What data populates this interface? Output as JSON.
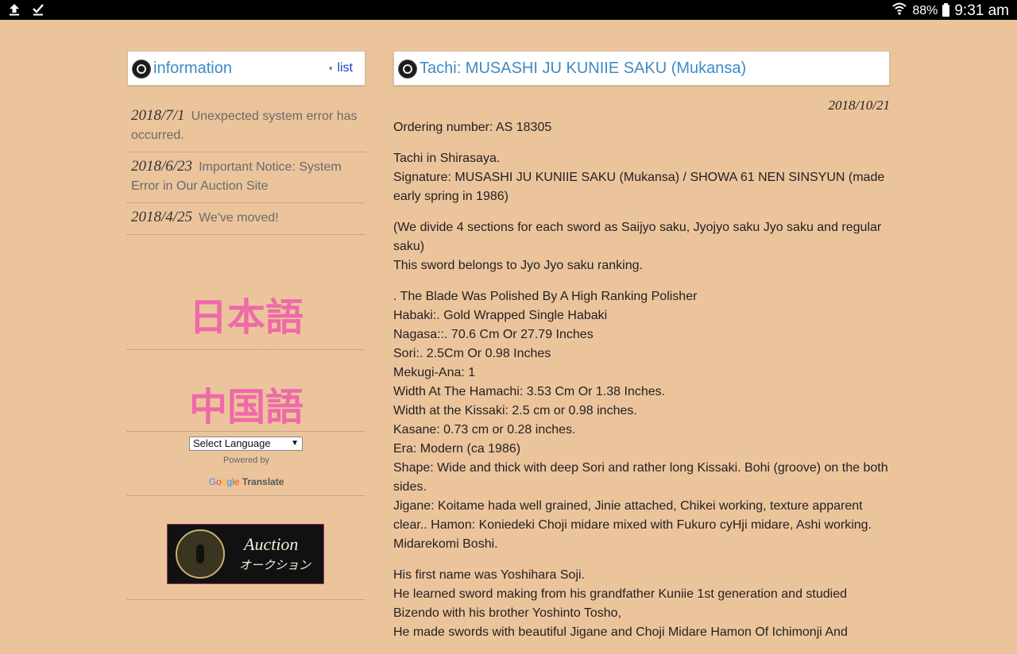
{
  "status_bar": {
    "battery": "88%",
    "time": "9:31 am"
  },
  "sidebar": {
    "info_title": "information",
    "list_label": "list",
    "news": [
      {
        "date": "2018/7/1",
        "text": "Unexpected system error has occurred."
      },
      {
        "date": "2018/6/23",
        "text": "Important Notice: System Error in Our Auction Site"
      },
      {
        "date": "2018/4/25",
        "text": "We've moved!"
      }
    ],
    "lang_japanese": "日本語",
    "lang_chinese": "中国語",
    "select_language": "Select Language",
    "powered_by": "Powered by",
    "google": [
      "G",
      "o",
      "o",
      "g",
      "l",
      "e"
    ],
    "translate": "Translate",
    "auction_en": "Auction",
    "auction_jp": "オークション"
  },
  "article": {
    "title": "Tachi: MUSASHI JU KUNIIE SAKU (Mukansa)",
    "date": "2018/10/21",
    "ordering": "Ordering number: AS 18305",
    "p1": [
      "Tachi in Shirasaya.",
      "Signature: MUSASHI JU KUNIIE SAKU (Mukansa) / SHOWA 61 NEN SINSYUN (made early spring in 1986)"
    ],
    "p2": [
      "(We divide 4 sections for each sword as Saijyo saku, Jyojyo saku Jyo saku and regular saku)",
      "This sword belongs to Jyo Jyo saku ranking."
    ],
    "p3": [
      ". The Blade Was Polished By A High Ranking Polisher",
      "Habaki:. Gold Wrapped Single Habaki",
      "Nagasa::. 70.6 Cm Or 27.79 Inches",
      "Sori:. 2.5Cm Or 0.98 Inches",
      "Mekugi-Ana: 1",
      "Width At The Hamachi: 3.53 Cm Or 1.38 Inches.",
      "Width at the Kissaki: 2.5 cm or 0.98 inches.",
      "Kasane: 0.73 cm or 0.28 inches.",
      "Era: Modern (ca 1986)",
      "Shape: Wide and thick with deep Sori and rather long Kissaki. Bohi (groove) on the both sides.",
      "Jigane: Koitame hada well grained, Jinie attached, Chikei working, texture apparent clear.. Hamon: Koniedeki Choji midare mixed with Fukuro cyHji midare, Ashi working. Midarekomi Boshi."
    ],
    "p4": [
      "His first name was Yoshihara Soji.",
      "He learned sword making from his grandfather Kuniie 1st generation and studied Bizendo with his brother Yoshinto Tosho,",
      "He made swords with beautiful Jigane and Choji Midare Hamon Of Ichimonji And"
    ]
  }
}
